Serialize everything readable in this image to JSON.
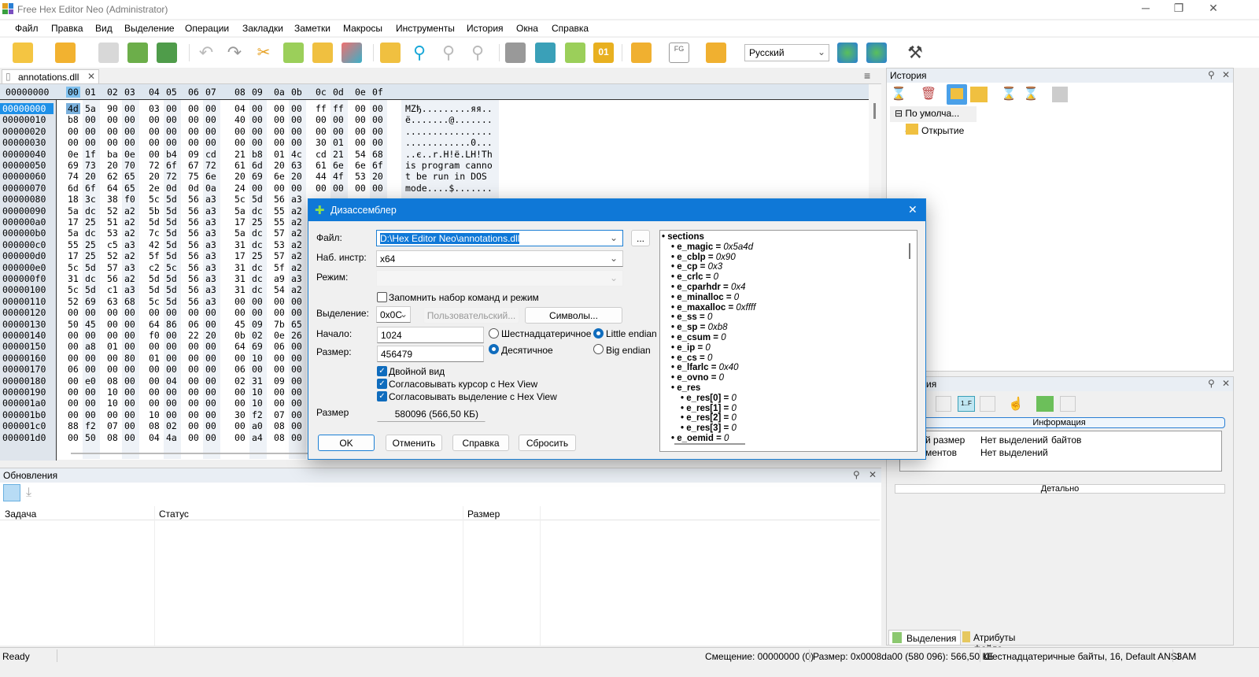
{
  "window": {
    "title": "Free Hex Editor Neo (Administrator)"
  },
  "menu": [
    "Файл",
    "Правка",
    "Вид",
    "Выделение",
    "Операции",
    "Закладки",
    "Заметки",
    "Макросы",
    "Инструменты",
    "История",
    "Окна",
    "Справка"
  ],
  "toolbar": {
    "language": "Русский"
  },
  "file_tab": {
    "label": "annotations.dll"
  },
  "hex": {
    "corner": "00000000",
    "columns": [
      "00",
      "01",
      "02",
      "03",
      "04",
      "05",
      "06",
      "07",
      "08",
      "09",
      "0a",
      "0b",
      "0c",
      "0d",
      "0e",
      "0f"
    ],
    "rows": [
      {
        "addr": "00000000",
        "bytes": "4d 5a 90 00 03 00 00 00 04 00 00 00 ff ff 00 00",
        "ascii": "MZђ.........яя.."
      },
      {
        "addr": "00000010",
        "bytes": "b8 00 00 00 00 00 00 00 40 00 00 00 00 00 00 00",
        "ascii": "ё.......@......."
      },
      {
        "addr": "00000020",
        "bytes": "00 00 00 00 00 00 00 00 00 00 00 00 00 00 00 00",
        "ascii": "................"
      },
      {
        "addr": "00000030",
        "bytes": "00 00 00 00 00 00 00 00 00 00 00 00 30 01 00 00",
        "ascii": "............0..."
      },
      {
        "addr": "00000040",
        "bytes": "0e 1f ba 0e 00 b4 09 cd 21 b8 01 4c cd 21 54 68",
        "ascii": "..є..r.Н!ё.LН!Th"
      },
      {
        "addr": "00000050",
        "bytes": "69 73 20 70 72 6f 67 72 61 6d 20 63 61 6e 6e 6f",
        "ascii": "is program canno"
      },
      {
        "addr": "00000060",
        "bytes": "74 20 62 65 20 72 75 6e 20 69 6e 20 44 4f 53 20",
        "ascii": "t be run in DOS "
      },
      {
        "addr": "00000070",
        "bytes": "6d 6f 64 65 2e 0d 0d 0a 24 00 00 00 00 00 00 00",
        "ascii": "mode....$......."
      },
      {
        "addr": "00000080",
        "bytes": "18 3c 38 f0 5c 5d 56 a3 5c 5d 56 a3",
        "ascii": ""
      },
      {
        "addr": "00000090",
        "bytes": "5a dc 52 a2 5b 5d 56 a3 5a dc 55 a2",
        "ascii": ""
      },
      {
        "addr": "000000a0",
        "bytes": "17 25 51 a2 5d 5d 56 a3 17 25 55 a2",
        "ascii": ""
      },
      {
        "addr": "000000b0",
        "bytes": "5a dc 53 a2 7c 5d 56 a3 5a dc 57 a2",
        "ascii": ""
      },
      {
        "addr": "000000c0",
        "bytes": "55 25 c5 a3 42 5d 56 a3 31 dc 53 a2",
        "ascii": ""
      },
      {
        "addr": "000000d0",
        "bytes": "17 25 52 a2 5f 5d 56 a3 17 25 57 a2",
        "ascii": ""
      },
      {
        "addr": "000000e0",
        "bytes": "5c 5d 57 a3 c2 5c 56 a3 31 dc 5f a2",
        "ascii": ""
      },
      {
        "addr": "000000f0",
        "bytes": "31 dc 56 a2 5d 5d 56 a3 31 dc a9 a3",
        "ascii": ""
      },
      {
        "addr": "00000100",
        "bytes": "5c 5d c1 a3 5d 5d 56 a3 31 dc 54 a2",
        "ascii": ""
      },
      {
        "addr": "00000110",
        "bytes": "52 69 63 68 5c 5d 56 a3 00 00 00 00",
        "ascii": ""
      },
      {
        "addr": "00000120",
        "bytes": "00 00 00 00 00 00 00 00 00 00 00 00",
        "ascii": ""
      },
      {
        "addr": "00000130",
        "bytes": "50 45 00 00 64 86 06 00 45 09 7b 65",
        "ascii": ""
      },
      {
        "addr": "00000140",
        "bytes": "00 00 00 00 f0 00 22 20 0b 02 0e 26",
        "ascii": ""
      },
      {
        "addr": "00000150",
        "bytes": "00 a8 01 00 00 00 00 00 64 69 06 00",
        "ascii": ""
      },
      {
        "addr": "00000160",
        "bytes": "00 00 00 80 01 00 00 00 00 10 00 00",
        "ascii": ""
      },
      {
        "addr": "00000170",
        "bytes": "06 00 00 00 00 00 00 00 06 00 00 00",
        "ascii": ""
      },
      {
        "addr": "00000180",
        "bytes": "00 e0 08 00 00 04 00 00 02 31 09 00",
        "ascii": ""
      },
      {
        "addr": "00000190",
        "bytes": "00 00 10 00 00 00 00 00 00 10 00 00",
        "ascii": ""
      },
      {
        "addr": "000001a0",
        "bytes": "00 00 10 00 00 00 00 00 00 10 00 00",
        "ascii": ""
      },
      {
        "addr": "000001b0",
        "bytes": "00 00 00 00 10 00 00 00 30 f2 07 00",
        "ascii": ""
      },
      {
        "addr": "000001c0",
        "bytes": "88 f2 07 00 08 02 00 00 00 a0 08 00",
        "ascii": ""
      },
      {
        "addr": "000001d0",
        "bytes": "00 50 08 00 04 4a 00 00 00 a4 08 00",
        "ascii": ""
      }
    ]
  },
  "updates": {
    "title": "Обновления",
    "columns": [
      "Задача",
      "Статус",
      "Размер"
    ]
  },
  "history": {
    "title": "История",
    "root": "По умолча...",
    "items": [
      "Открытие"
    ]
  },
  "selections": {
    "title_visible": "ия",
    "info_header": "Информация",
    "rows": [
      [
        "й размер",
        "Нет выделений",
        "байтов"
      ],
      [
        "ментов",
        "Нет выделений",
        ""
      ]
    ],
    "detail_header": "Детально"
  },
  "bottom_tabs": [
    "Выделения",
    "Атрибуты файла"
  ],
  "status": {
    "ready": "Ready",
    "offset": "Смещение: 00000000 (0)",
    "size": "Размер: 0x0008da00 (580 096): 566,50 КБ",
    "mode": "Шестнадцатеричные байты, 16, Default ANSI",
    "ins": "ЗАМ"
  },
  "dialog": {
    "title": "Дизассемблер",
    "file_label": "Файл:",
    "file_value": "D:\\Hex Editor Neo\\annotations.dll",
    "browse": "...",
    "isa_label": "Наб. инстр:",
    "isa_value": "x64",
    "mode_label": "Режим:",
    "remember": "Запомнить набор команд и режим",
    "selection_label": "Выделение:",
    "selection_value": "0x0C",
    "custom_btn": "Пользовательский...",
    "symbols_btn": "Символы...",
    "start_label": "Начало:",
    "start_value": "1024",
    "size_label": "Размер:",
    "size_value": "456479",
    "hex_radio": "Шестнадцатеричное",
    "dec_radio": "Десятичное",
    "le_radio": "Little endian",
    "be_radio": "Big endian",
    "dual_view": "Двойной вид",
    "sync_cursor": "Согласовывать курсор с Hex View",
    "sync_sel": "Согласовывать выделение с Hex View",
    "total_label": "Размер",
    "total_value": "580096 (566,50 КБ)",
    "ok": "OK",
    "cancel": "Отменить",
    "help": "Справка",
    "reset": "Сбросить",
    "tree": [
      {
        "name": "sections",
        "value": "",
        "level": 0
      },
      {
        "name": "e_magic",
        "value": "0x5a4d",
        "level": 1
      },
      {
        "name": "e_cblp",
        "value": "0x90",
        "level": 1
      },
      {
        "name": "e_cp",
        "value": "0x3",
        "level": 1
      },
      {
        "name": "e_crlc",
        "value": "0",
        "level": 1
      },
      {
        "name": "e_cparhdr",
        "value": "0x4",
        "level": 1
      },
      {
        "name": "e_minalloc",
        "value": "0",
        "level": 1
      },
      {
        "name": "e_maxalloc",
        "value": "0xffff",
        "level": 1
      },
      {
        "name": "e_ss",
        "value": "0",
        "level": 1
      },
      {
        "name": "e_sp",
        "value": "0xb8",
        "level": 1
      },
      {
        "name": "e_csum",
        "value": "0",
        "level": 1
      },
      {
        "name": "e_ip",
        "value": "0",
        "level": 1
      },
      {
        "name": "e_cs",
        "value": "0",
        "level": 1
      },
      {
        "name": "e_lfarlc",
        "value": "0x40",
        "level": 1
      },
      {
        "name": "e_ovno",
        "value": "0",
        "level": 1
      },
      {
        "name": "e_res",
        "value": "",
        "level": 1
      },
      {
        "name": "e_res[0]",
        "value": "0",
        "level": 2
      },
      {
        "name": "e_res[1]",
        "value": "0",
        "level": 2
      },
      {
        "name": "e_res[2]",
        "value": "0",
        "level": 2
      },
      {
        "name": "e_res[3]",
        "value": "0",
        "level": 2
      },
      {
        "name": "e_oemid",
        "value": "0",
        "level": 1
      }
    ]
  }
}
